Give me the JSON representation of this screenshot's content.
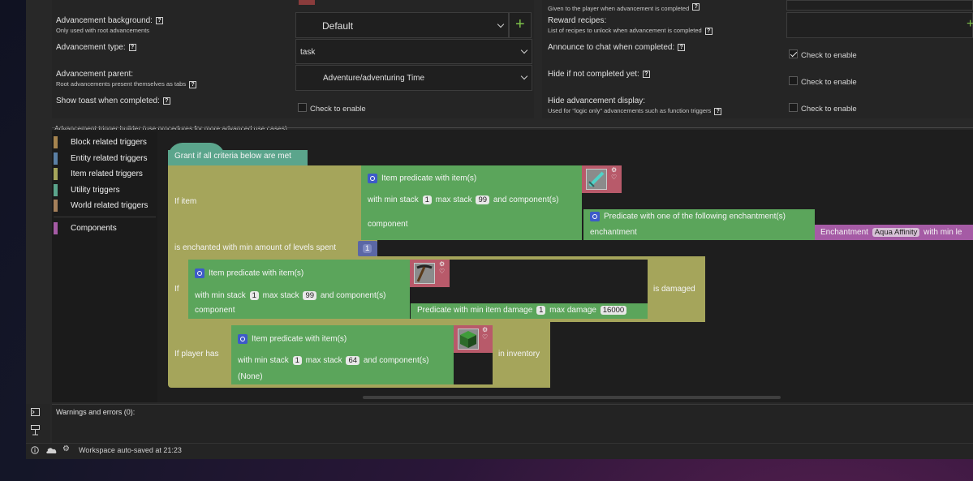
{
  "settings": {
    "left": {
      "background_label": "Advancement background:",
      "background_sub": "Only used with root advancements",
      "type_label": "Advancement type:",
      "parent_label": "Advancement parent:",
      "parent_sub": "Root advancements present themselves as tabs",
      "toast_label": "Show toast when completed:"
    },
    "controls": {
      "background_value": "Default",
      "type_value": "task",
      "parent_value": "Adventure/adventuring Time",
      "toast_checkbox": "Check to enable",
      "add_symbol": "+"
    },
    "right": {
      "reward_top_sub": "Given to the player when advancement is completed",
      "recipes_label": "Reward recipes:",
      "recipes_sub": "List of recipes to unlock when advancement is completed",
      "announce_label": "Announce to chat when completed:",
      "hide_label": "Hide if not completed yet:",
      "hide_display_label": "Hide advancement display:",
      "hide_display_sub": "Used for \"logic only\" advancements such as function triggers",
      "announce_checkbox": "Check to enable",
      "hide_checkbox": "Check to enable",
      "hide_display_checkbox": "Check to enable"
    },
    "help_glyph": "?"
  },
  "builder": {
    "title": "Advancement trigger builder (use procedures for more advanced use cases)",
    "categories": [
      {
        "label": "Block related triggers",
        "color": "#a6844f"
      },
      {
        "label": "Entity related triggers",
        "color": "#5b80a5"
      },
      {
        "label": "Item related triggers",
        "color": "#a5a55b"
      },
      {
        "label": "Utility triggers",
        "color": "#5ba58c"
      },
      {
        "label": "World related triggers",
        "color": "#a5805b"
      },
      {
        "label": "Components",
        "color": "#a55ba5"
      }
    ],
    "blocks": {
      "hat": "Grant if all criteria below are met",
      "if_item": "If item",
      "enchanted": "is enchanted with min amount of levels spent",
      "enchanted_val": "1",
      "pred1_title": "Item predicate with item(s)",
      "pred1_min_pre": "with min stack",
      "pred1_min": "1",
      "pred1_max_pre": "max stack",
      "pred1_max": "99",
      "pred1_post": "and component(s)",
      "pred1_component": "component",
      "ench_pred": "Predicate with one of the following enchantment(s)",
      "ench_field": "enchantment",
      "ench_block": "Enchantment",
      "ench_value": "Aqua Affinity",
      "ench_tail": "with min le",
      "if2": "If",
      "pred2_title": "Item predicate with item(s)",
      "pred2_min_pre": "with min stack",
      "pred2_min": "1",
      "pred2_max_pre": "max stack",
      "pred2_max": "99",
      "pred2_post": "and component(s)",
      "pred2_component": "component",
      "damage_pre": "Predicate with min item damage",
      "damage_min": "1",
      "damage_max_pre": "max damage",
      "damage_max": "16000",
      "is_damaged": "is damaged",
      "if_player": "If player has",
      "pred3_title": "Item predicate with item(s)",
      "pred3_min_pre": "with min stack",
      "pred3_min": "1",
      "pred3_max_pre": "max stack",
      "pred3_max": "64",
      "pred3_post": "and component(s)",
      "pred3_none": "(None)",
      "in_inventory": "in inventory"
    }
  },
  "console": {
    "warnings": "Warnings and errors (0):"
  },
  "status": {
    "text": "Workspace auto-saved at 21:23"
  },
  "colors": {
    "item_block": "#a5a55b",
    "predicate": "#5ba55b",
    "component": "#a55ba5",
    "hat": "#5ba58c",
    "picker": "#b85a6a"
  },
  "icons": [
    "help-icon",
    "chevron-down-icon",
    "plus-icon",
    "checkbox-icon",
    "gear-icon",
    "diamond-sword-icon",
    "pickaxe-icon",
    "grass-block-icon",
    "terminal-icon",
    "info-icon",
    "cloud-icon",
    "settings-icon"
  ]
}
